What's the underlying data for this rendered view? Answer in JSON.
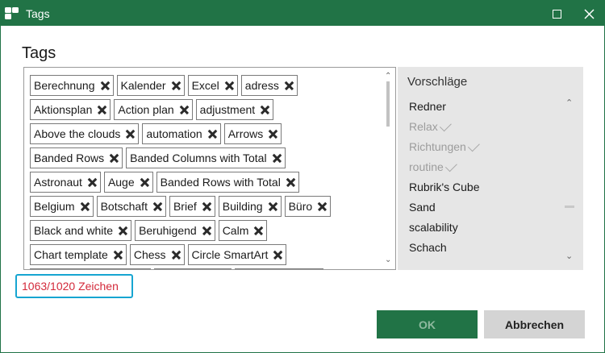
{
  "window": {
    "title": "Tags",
    "accent_color": "#217346"
  },
  "dialog": {
    "heading": "Tags"
  },
  "tags": {
    "rows": [
      [
        "Berechnung",
        "Kalender",
        "Excel",
        "adress"
      ],
      [
        "Aktionsplan",
        "Action plan",
        "adjustment"
      ],
      [
        "Above the clouds",
        "automation",
        "Arrows"
      ],
      [
        "Banded Rows",
        "Banded Columns with Total"
      ],
      [
        "Astronaut",
        "Auge",
        "Banded Rows with Total"
      ],
      [
        "Belgium",
        "Botschaft",
        "Brief",
        "Building",
        "Büro"
      ],
      [
        "Black and white",
        "Beruhigend",
        "Calm"
      ],
      [
        "Chart template",
        "Chess",
        "Circle SmartArt"
      ]
    ]
  },
  "suggestions": {
    "title": "Vorschläge",
    "items": [
      {
        "label": "Redner",
        "used": false
      },
      {
        "label": "Relax",
        "used": true
      },
      {
        "label": "Richtungen",
        "used": true
      },
      {
        "label": "routine",
        "used": true
      },
      {
        "label": "Rubrik's Cube",
        "used": false
      },
      {
        "label": "Sand",
        "used": false
      },
      {
        "label": "scalability",
        "used": false
      },
      {
        "label": "Schach",
        "used": false
      }
    ]
  },
  "counter": {
    "text": "1063/1020 Zeichen",
    "color": "#d3293a"
  },
  "buttons": {
    "ok": "OK",
    "cancel": "Abbrechen"
  }
}
